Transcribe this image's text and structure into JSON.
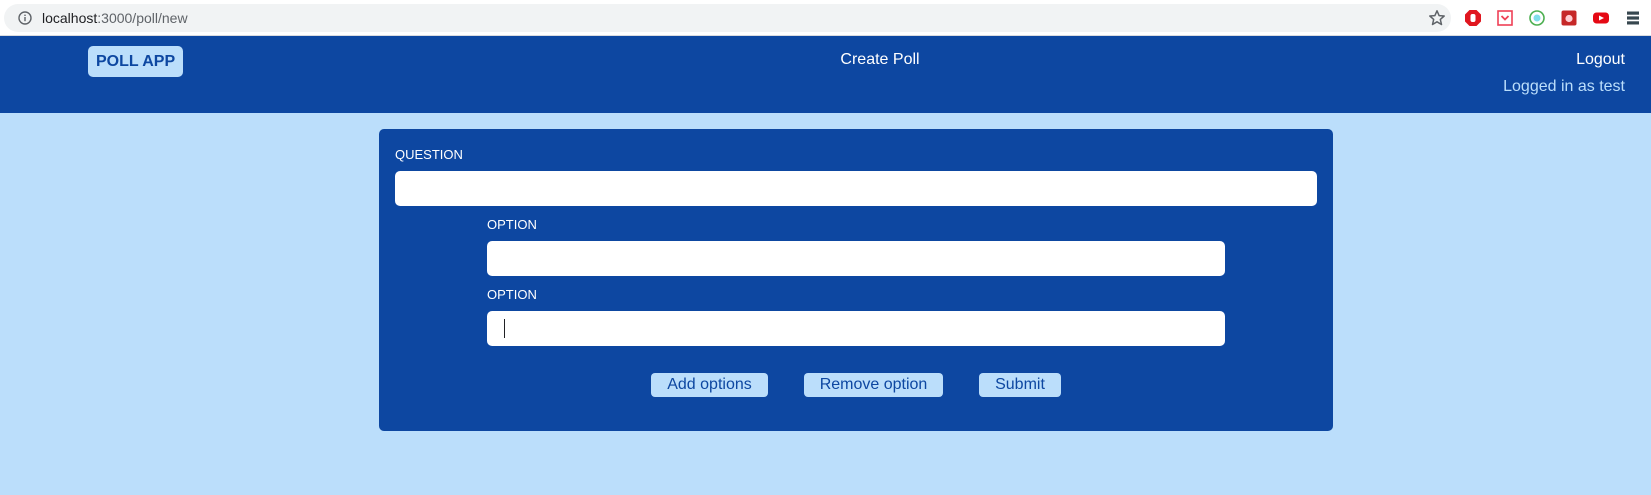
{
  "browser": {
    "url_host": "localhost",
    "url_path": ":3000/poll/new",
    "icons": [
      "info-icon",
      "star-icon",
      "adblock-extension-icon",
      "pocket-extension-icon",
      "colorzilla-extension-icon",
      "screenshot-extension-icon",
      "youtube-extension-icon",
      "menu-extension-icon"
    ]
  },
  "header": {
    "brand": "POLL APP",
    "create_poll": "Create Poll",
    "logout": "Logout",
    "logged_in": "Logged in as test"
  },
  "form": {
    "question_label": "QUESTION",
    "question_value": "",
    "options": [
      {
        "label": "OPTION",
        "value": ""
      },
      {
        "label": "OPTION",
        "value": ""
      }
    ],
    "buttons": {
      "add": "Add options",
      "remove": "Remove option",
      "submit": "Submit"
    }
  },
  "colors": {
    "primary": "#0d47a1",
    "light": "#bbdefb"
  }
}
